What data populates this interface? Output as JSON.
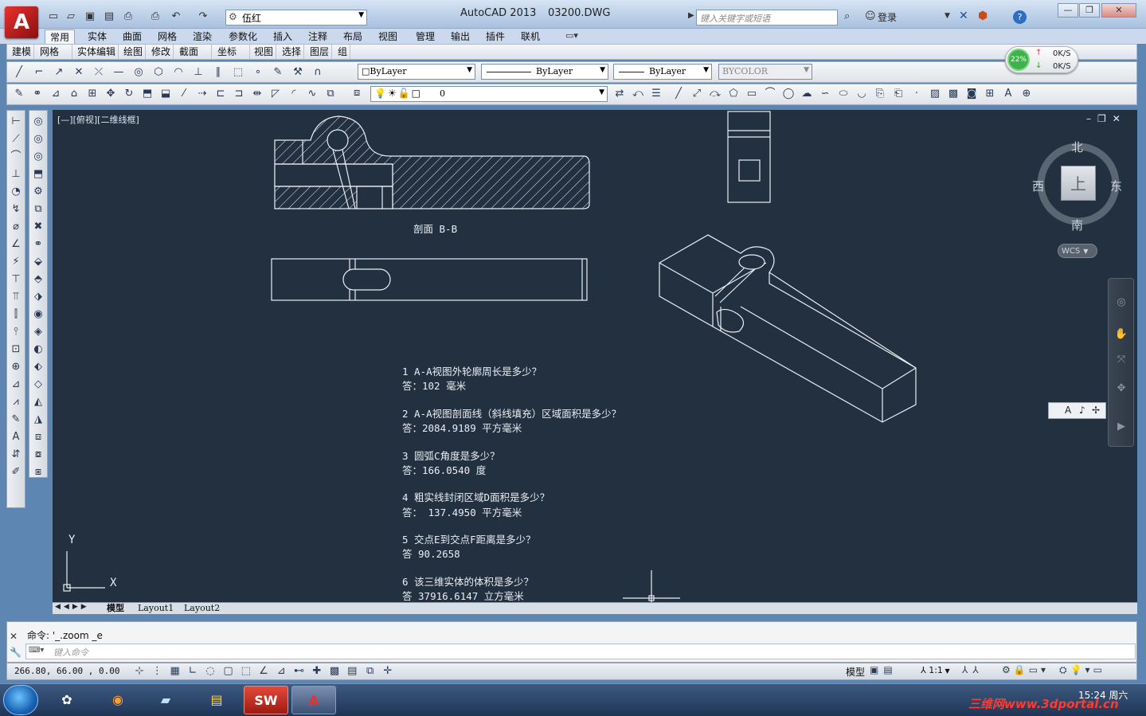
{
  "window": {
    "app_title": "AutoCAD 2013",
    "file_title": "03200.DWG",
    "workspace": "伍红",
    "search_placeholder": "键入关键字或短语",
    "login": "登录"
  },
  "ribbon_tabs": [
    "常用",
    "实体",
    "曲面",
    "网格",
    "渲染",
    "参数化",
    "插入",
    "注释",
    "布局",
    "视图",
    "管理",
    "输出",
    "插件",
    "联机"
  ],
  "menus": [
    "建模",
    "网格",
    "实体编辑",
    "绘图",
    "修改",
    "截面",
    "坐标",
    "视图",
    "选择",
    "图层",
    "组"
  ],
  "properties": {
    "color": "ByLayer",
    "linetype": "ByLayer",
    "lineweight": "ByLayer",
    "plotstyle": "BYCOLOR",
    "layer": "0"
  },
  "network": {
    "percent": "22%",
    "up": "0K/S",
    "down": "0K/S"
  },
  "viewport": {
    "label": "[—][俯视][二维线框]",
    "section_label": "剖面  B-B",
    "ucs_x": "X",
    "ucs_y": "Y"
  },
  "viewcube": {
    "north": "北",
    "south": "南",
    "west": "西",
    "east": "东",
    "top": "上",
    "wcs": "WCS"
  },
  "questions": [
    {
      "q": "1 A-A视图外轮廓周长是多少？",
      "a": "答：102 毫米"
    },
    {
      "q": "2 A-A视图剖面线（斜线填充）区域面积是多少？",
      "a": "答：2084.9189 平方毫米"
    },
    {
      "q": "3 圆弧C角度是多少？",
      "a": "答：166.0540  度"
    },
    {
      "q": "4 粗实线封闭区域D面积是多少？",
      "a": "答： 137.4950 平方毫米"
    },
    {
      "q": "5 交点E到交点F距离是多少？",
      "a": "答 90.2658"
    },
    {
      "q": "6 该三维实体的体积是多少？",
      "a": "答 37916.6147  立方毫米"
    }
  ],
  "layout_tabs": [
    "模型",
    "Layout1",
    "Layout2"
  ],
  "command": {
    "history": "命令: '_.zoom _e",
    "placeholder": "键入命令"
  },
  "status": {
    "coords": "266.80, 66.00 , 0.00",
    "model": "模型",
    "scale": "1:1"
  },
  "taskbar": {
    "time": "15:24 周六",
    "watermark": "三维网www.3dportal.cn"
  },
  "colors": {
    "drawing_bg": "#233040",
    "line": "#e9eef3",
    "accent_red": "#e8312e"
  }
}
